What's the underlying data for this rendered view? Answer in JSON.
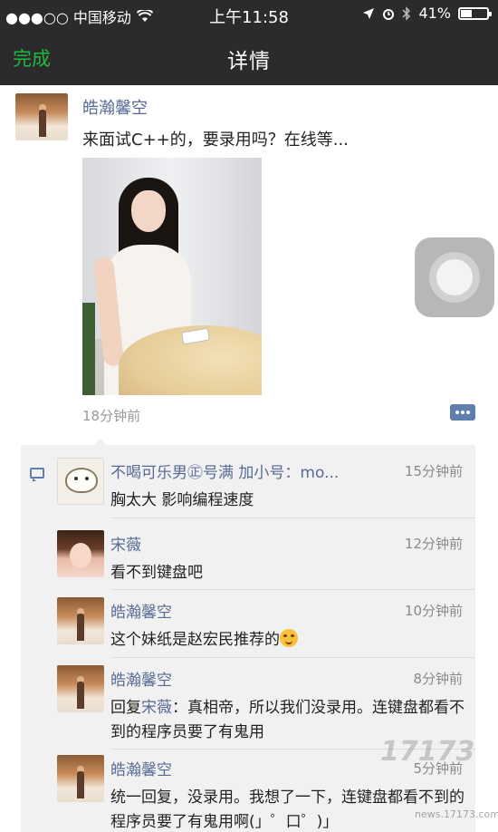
{
  "status_bar": {
    "carrier": "●●●○○ 中国移动",
    "time": "上午11:58",
    "battery": "41%",
    "battery_level": 0.41
  },
  "nav": {
    "done": "完成",
    "title": "详情"
  },
  "post": {
    "author": "皓瀚馨空",
    "text": "来面试C++的，要录用吗？在线等...",
    "time": "18分钟前"
  },
  "comments": [
    {
      "author": "不喝可乐男㊣号满 加小号：mo...",
      "time": "15分钟前",
      "text": "胸太大 影响编程速度"
    },
    {
      "author": "宋薇",
      "time": "12分钟前",
      "text": "看不到键盘吧"
    },
    {
      "author": "皓瀚馨空",
      "time": "10分钟前",
      "text": "这个妹纸是赵宏民推荐的"
    },
    {
      "author": "皓瀚馨空",
      "time": "8分钟前",
      "reply_prefix": "回复",
      "reply_to": "宋薇",
      "text": "：真相帝，所以我们没录用。连键盘都看不到的程序员要了有鬼用"
    },
    {
      "author": "皓瀚馨空",
      "time": "5分钟前",
      "text": "统一回复，没录用。我想了一下，连键盘都看不到的程序员要了有鬼用啊(」゜口゜)」"
    }
  ],
  "watermark": {
    "text": "17173",
    "sub_text": "news.17173.com"
  },
  "colors": {
    "bar_bg": "#2b2b2d",
    "done_green": "#1dbb3b",
    "name_blue": "#576b95",
    "comment_bg": "#f1f1f1"
  }
}
